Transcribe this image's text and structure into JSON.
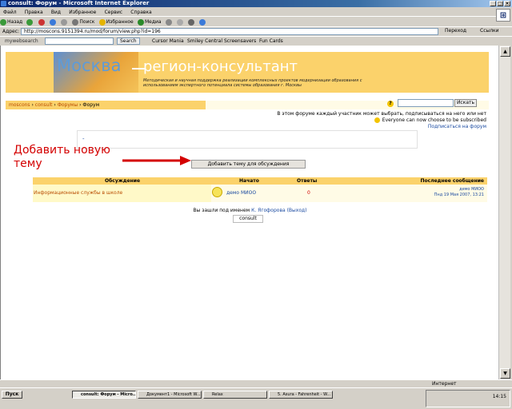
{
  "window": {
    "title": "consult: Форум - Microsoft Internet Explorer"
  },
  "menu": [
    "Файл",
    "Правка",
    "Вид",
    "Избранное",
    "Сервис",
    "Справка"
  ],
  "toolbar": {
    "back": "Назад",
    "search": "Поиск",
    "favorites": "Избранное",
    "media": "Медиа"
  },
  "address": {
    "label": "Адрес:",
    "url": "http://moscons.9151394.ru/mod/forum/view.php?id=196",
    "go": "Переход",
    "links": "Ссылки"
  },
  "mws": {
    "logo": "mywebsearch",
    "search_btn": "Search",
    "links": [
      "Cursor Mania",
      "Smiley Central",
      "Screensavers",
      "Fun Cards"
    ]
  },
  "banner": {
    "city": "Москва",
    "title": "регион-консультант",
    "subtitle": "Методическая и научная поддержка реализации комплексных проектов модернизации образования с использованием экспертного потенциала системы образования г. Москвы"
  },
  "breadcrumbs": [
    "moscons",
    "consult",
    "Форумы",
    "Форум"
  ],
  "forum_search": {
    "button": "Искать"
  },
  "info_line1": "В этом форуме каждый участник может выбрать, подписываться на него или нет",
  "info_line2": "Everyone can now choose to be subscribed",
  "subscribe_link": "Подписаться на форум",
  "description_box": "-",
  "annotation": "Добавить новую тему",
  "add_topic_button": "Добавить тему для обсуждения",
  "table": {
    "headers": [
      "Обсуждение",
      "Начато",
      "Ответы",
      "Последнее сообщение"
    ],
    "rows": [
      {
        "discussion": "Информационные службы в школе",
        "started_by": "демо МИОО",
        "replies": "0",
        "last_author": "демо МИОО",
        "last_date": "Пнд 19 Мая 2007, 13:21"
      }
    ]
  },
  "footer": {
    "logged_in_prefix": "Вы зашли под именем",
    "user": "К. Ягофорова",
    "logout": "(Выход)",
    "course_btn": "consult"
  },
  "status": {
    "zone": "Интернет"
  },
  "taskbar": {
    "start": "Пуск",
    "tasks": [
      "consult: Форум - Micro...",
      "Документ1 - Microsoft W...",
      "Relax",
      "5. Asura - Fahrenheit - W..."
    ],
    "clock": "14:15"
  },
  "colors": {
    "banner": "#fbd26b",
    "link": "#1a4aa0",
    "annotation": "#d40000"
  }
}
